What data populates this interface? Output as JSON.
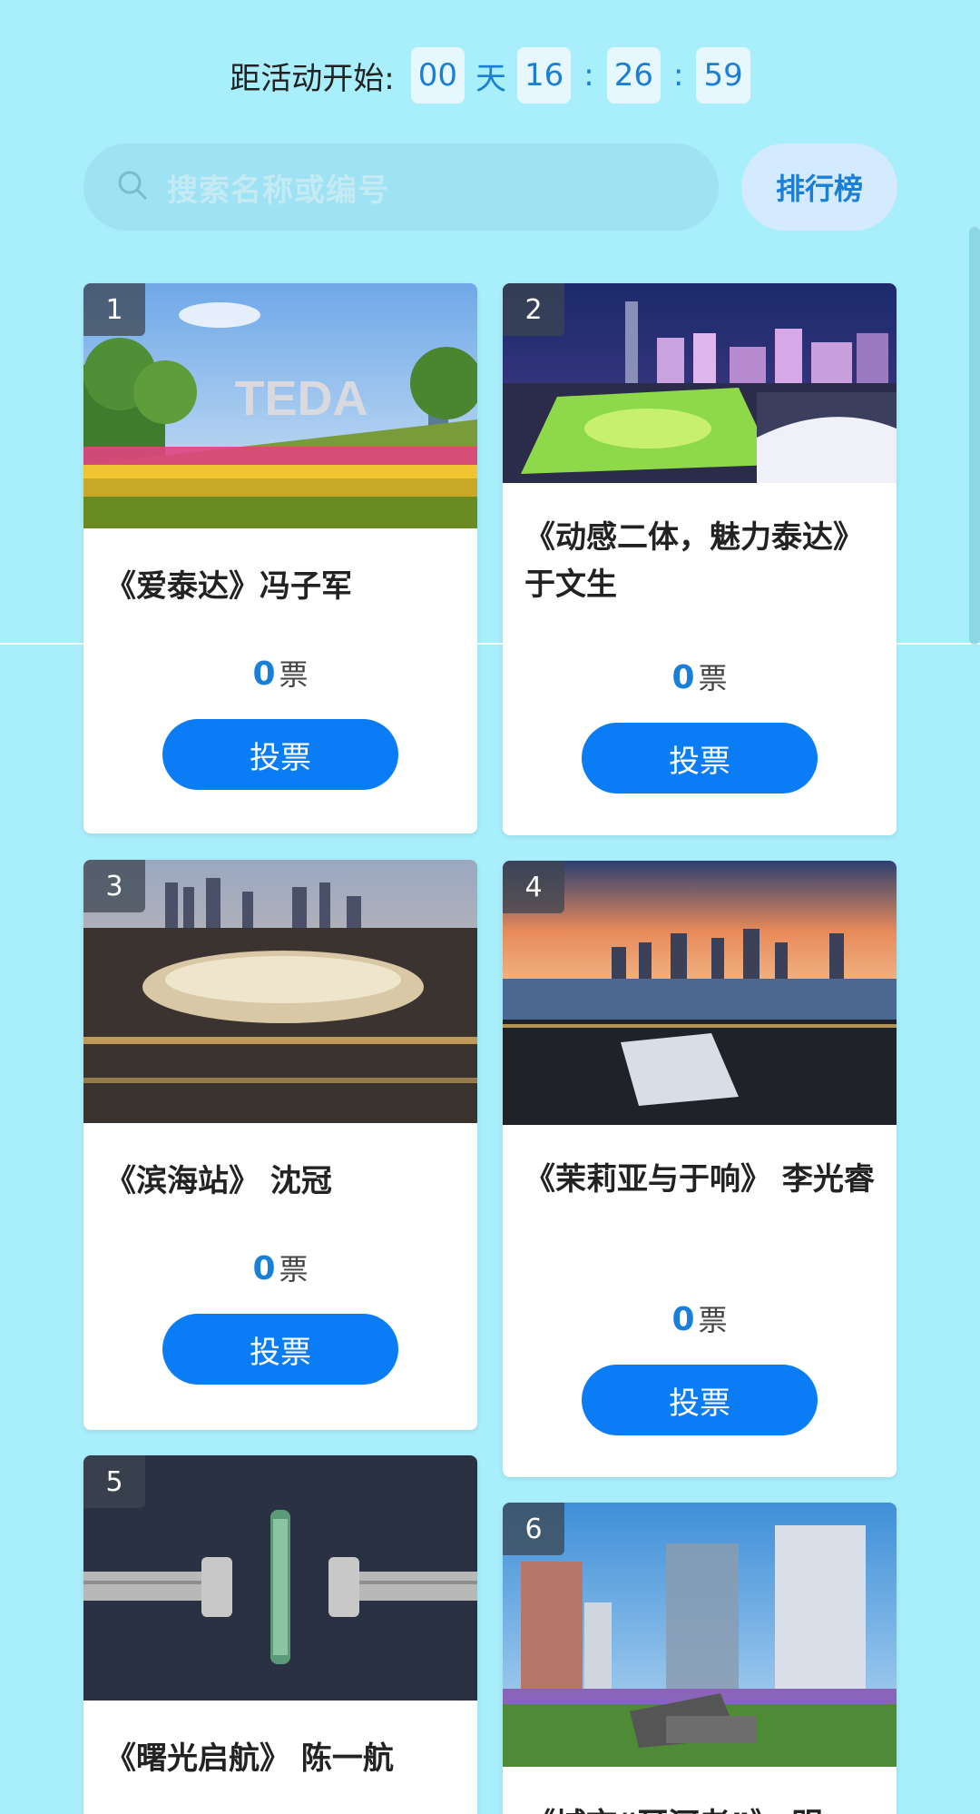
{
  "countdown": {
    "label": "距活动开始:",
    "days": "00",
    "day_unit": "天",
    "hours": "16",
    "minutes": "26",
    "seconds": "59",
    "colon": ":"
  },
  "search": {
    "placeholder": "搜索名称或编号",
    "icon": "search-icon"
  },
  "rank_button": "排行榜",
  "vote_unit": "票",
  "vote_button": "投票",
  "cards": [
    {
      "number": "1",
      "title": "《爱泰达》冯子军",
      "votes": "0"
    },
    {
      "number": "2",
      "title": "《动感二体，魅力泰达》 于文生",
      "votes": "0"
    },
    {
      "number": "3",
      "title": "《滨海站》 沈冠",
      "votes": "0"
    },
    {
      "number": "4",
      "title": "《茉莉亚与于响》 李光睿",
      "votes": "0"
    },
    {
      "number": "5",
      "title": "《曙光启航》 陈一航",
      "votes": ""
    },
    {
      "number": "6",
      "title": "《城市“耳河老”》 明",
      "votes": ""
    }
  ],
  "colors": {
    "background": "#a8eefb",
    "accent": "#0a7cf6",
    "accent_text": "#1a7fd6"
  }
}
